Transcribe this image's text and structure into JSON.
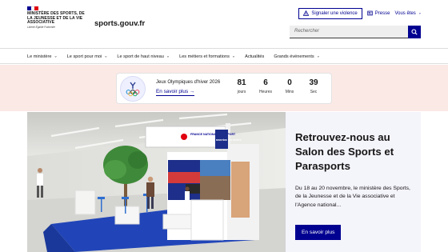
{
  "header": {
    "ministry_name": "Ministère des Sports, de la Jeunesse et de la Vie associative",
    "motto": "Liberté Égalité Fraternité",
    "site_name": "sports.gouv.fr",
    "report_violence_label": "Signaler une violence",
    "press_label": "Presse",
    "you_are_label": "Vous êtes",
    "search_placeholder": "Rechercher"
  },
  "nav": {
    "items": [
      {
        "label": "Le ministère"
      },
      {
        "label": "Le sport pour moi"
      },
      {
        "label": "Le sport de haut niveau"
      },
      {
        "label": "Les métiers et formations"
      },
      {
        "label": "Actualités"
      },
      {
        "label": "Grands événements"
      }
    ]
  },
  "countdown": {
    "title": "Jeux Olympiques d'hiver 2026",
    "link_label": "En savoir plus",
    "units": [
      {
        "value": "81",
        "label": "jours"
      },
      {
        "value": "6",
        "label": "Heures"
      },
      {
        "value": "0",
        "label": "Mins"
      },
      {
        "value": "39",
        "label": "Sec"
      }
    ]
  },
  "hero": {
    "title": "Retrouvez-nous au Salon des Sports et Parasports",
    "text": "Du 18 au 20 novembre, le ministère des Sports, de la Jeunesse et de la Vie associative et l'Agence national...",
    "button_label": "En savoir plus",
    "booth_sign": "FRANCE NATIONALE DU SPORT",
    "booth_side_sign": "MINISTÈRE DES SPORTS"
  },
  "colors": {
    "primary_blue": "#000091",
    "marianne_red": "#e1000f",
    "band_pink": "#fbe9e6",
    "panel_bg": "#f4f4fb"
  }
}
